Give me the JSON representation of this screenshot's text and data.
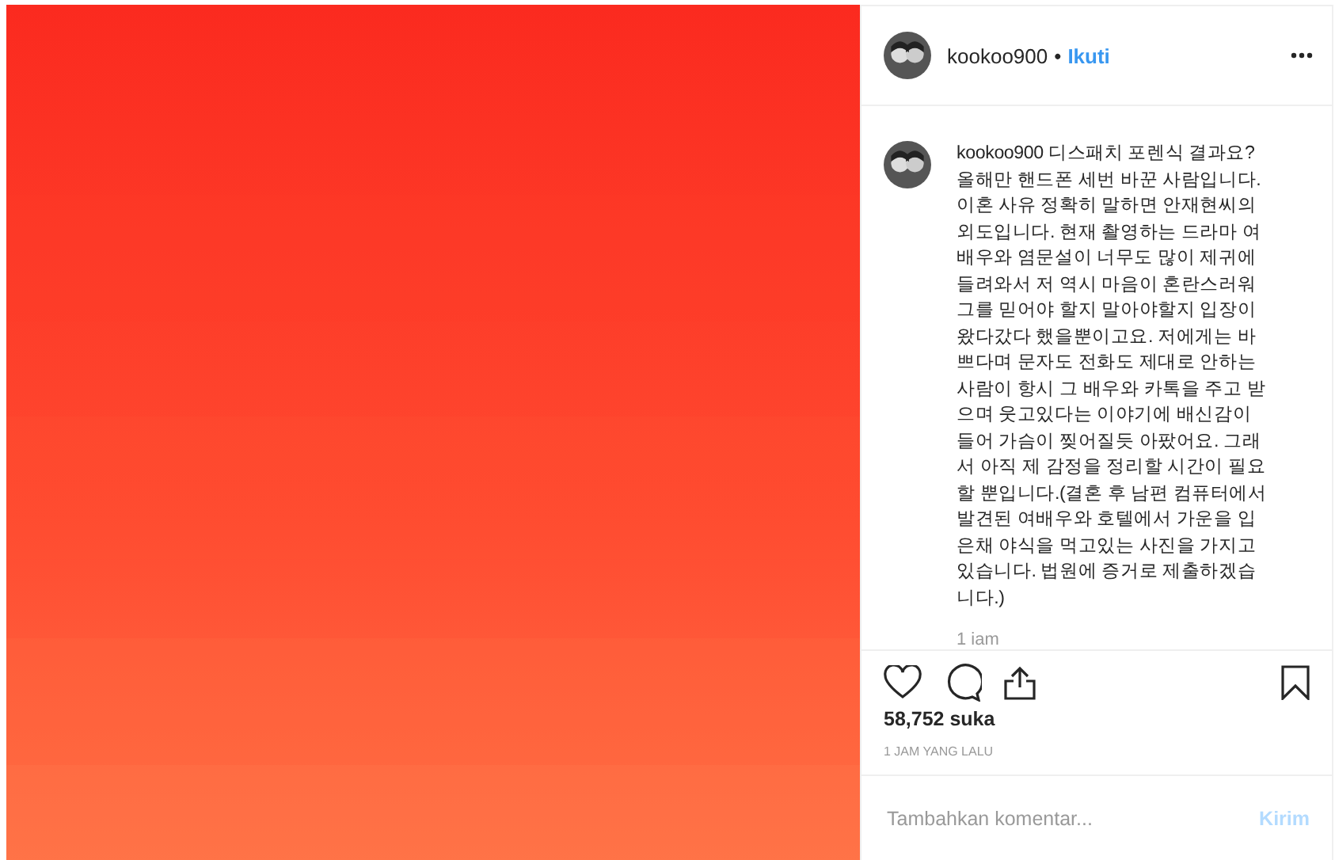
{
  "post": {
    "username": "kookoo900",
    "separator": "•",
    "follow": "Ikuti",
    "caption": {
      "text": "kookoo900 디스패치 포렌식 결과요? 올해만 핸드폰 세번 바꾼 사람입니다. 이혼 사유 정확히 말하면 안재현씨의 외도입니다. 현재 촬영하는 드라마 여배우와 염문설이 너무도 많이 제귀에 들려와서 저 역시 마음이 혼란스러워 그를 믿어야 할지 말아야할지 입장이 왔다갔다 했을뿐이고요. 저에게는 바쁘다며 문자도 전화도 제대로 안하는 사람이 항시 그 배우와 카톡을 주고 받으며 웃고있다는 이야기에 배신감이 들어 가슴이 찢어질듯 아팠어요. 그래서 아직 제 감정을 정리할 시간이 필요할 뿐입니다.(결혼 후 남편 컴퓨터에서 발견된 여배우와 호텔에서 가운을 입은채 야식을 먹고있는 사진을 가지고 있습니다. 법원에 증거로 제출하겠습니다.)",
      "time": "1 iam"
    },
    "likes": "58,752 suka",
    "posted": "1 JAM YANG LALU",
    "comment": {
      "placeholder": "Tambahkan komentar...",
      "submit": "Kirim"
    }
  }
}
